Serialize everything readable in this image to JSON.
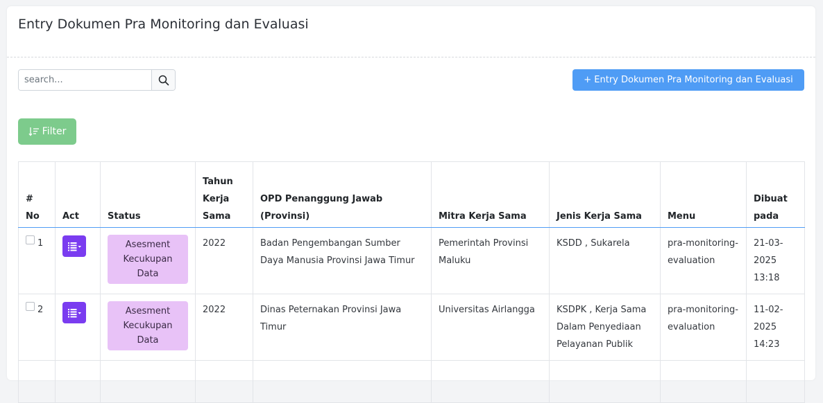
{
  "page": {
    "title": "Entry Dokumen Pra Monitoring dan Evaluasi"
  },
  "search": {
    "placeholder": "search...",
    "value": ""
  },
  "toolbar": {
    "entry_label": "+ Entry Dokumen Pra Monitoring dan Evaluasi",
    "filter_label": "Filter",
    "accent_color": "#4f9cf5",
    "filter_color": "#7dcb8c"
  },
  "table": {
    "headers": {
      "no": "# No",
      "act": "Act",
      "status": "Status",
      "tahun": "Tahun Kerja Sama",
      "opd": "OPD Penanggung Jawab (Provinsi)",
      "mitra": "Mitra Kerja Sama",
      "jenis": "Jenis Kerja Sama",
      "menu": "Menu",
      "dibuat": "Dibuat pada"
    },
    "rows": [
      {
        "no": "1",
        "status": "Asesment Kecukupan Data",
        "tahun": "2022",
        "opd": "Badan Pengembangan Sumber Daya Manusia Provinsi Jawa Timur",
        "mitra": "Pemerintah Provinsi Maluku",
        "jenis": "KSDD , Sukarela",
        "menu": "pra-monitoring-evaluation",
        "dibuat": "21-03-2025 13:18"
      },
      {
        "no": "2",
        "status": "Asesment Kecukupan Data",
        "tahun": "2022",
        "opd": "Dinas Peternakan Provinsi Jawa Timur",
        "mitra": "Universitas Airlangga",
        "jenis": "KSDPK , Kerja Sama Dalam Penyediaan Pelayanan Publik",
        "menu": "pra-monitoring-evaluation",
        "dibuat": "11-02-2025 14:23"
      }
    ]
  },
  "icons": {
    "search": "search-icon",
    "filter": "sort-icon",
    "action": "list-dropdown-icon"
  }
}
